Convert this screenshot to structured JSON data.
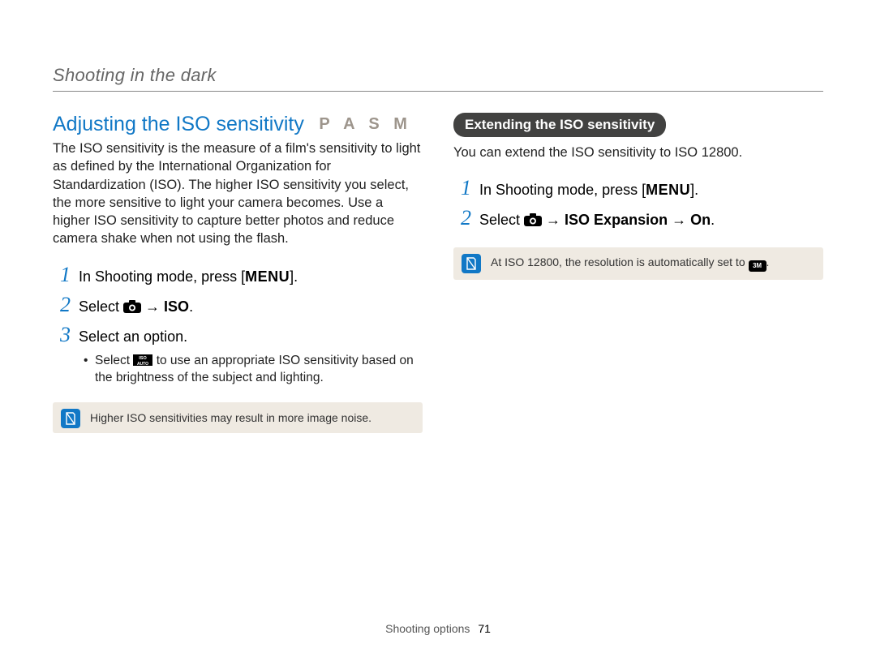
{
  "running_head": "Shooting in the dark",
  "left": {
    "title": "Adjusting the ISO sensitivity",
    "modes": "P A S M",
    "body": "The ISO sensitivity is the measure of a film's sensitivity to light as defined by the International Organization for Standardization (ISO). The higher ISO sensitivity you select, the more sensitive to light your camera becomes. Use a higher ISO sensitivity to capture better photos and reduce camera shake when not using the flash.",
    "step1_pre": "In Shooting mode, press [",
    "step1_menu": "MENU",
    "step1_post": "].",
    "step2_pre": "Select ",
    "step2_arrow": " → ",
    "step2_iso": "ISO",
    "step2_post": ".",
    "step3": "Select an option.",
    "bullet_pre": "Select ",
    "bullet_post": " to use an appropriate ISO sensitivity based on the brightness of the subject and lighting.",
    "note": "Higher ISO sensitivities may result in more image noise."
  },
  "right": {
    "pill": "Extending the ISO sensitivity",
    "body": "You can extend the ISO sensitivity to ISO 12800.",
    "step1_pre": "In Shooting mode, press [",
    "step1_menu": "MENU",
    "step1_post": "].",
    "step2_pre": "Select ",
    "step2_arrow1": " → ",
    "step2_isoexp": "ISO Expansion",
    "step2_arrow2": " → ",
    "step2_on": "On",
    "step2_post": ".",
    "note_pre": "At ISO 12800, the resolution is automatically set to ",
    "note_res": "3M",
    "note_post": "."
  },
  "footer_label": "Shooting options",
  "footer_page": "71"
}
